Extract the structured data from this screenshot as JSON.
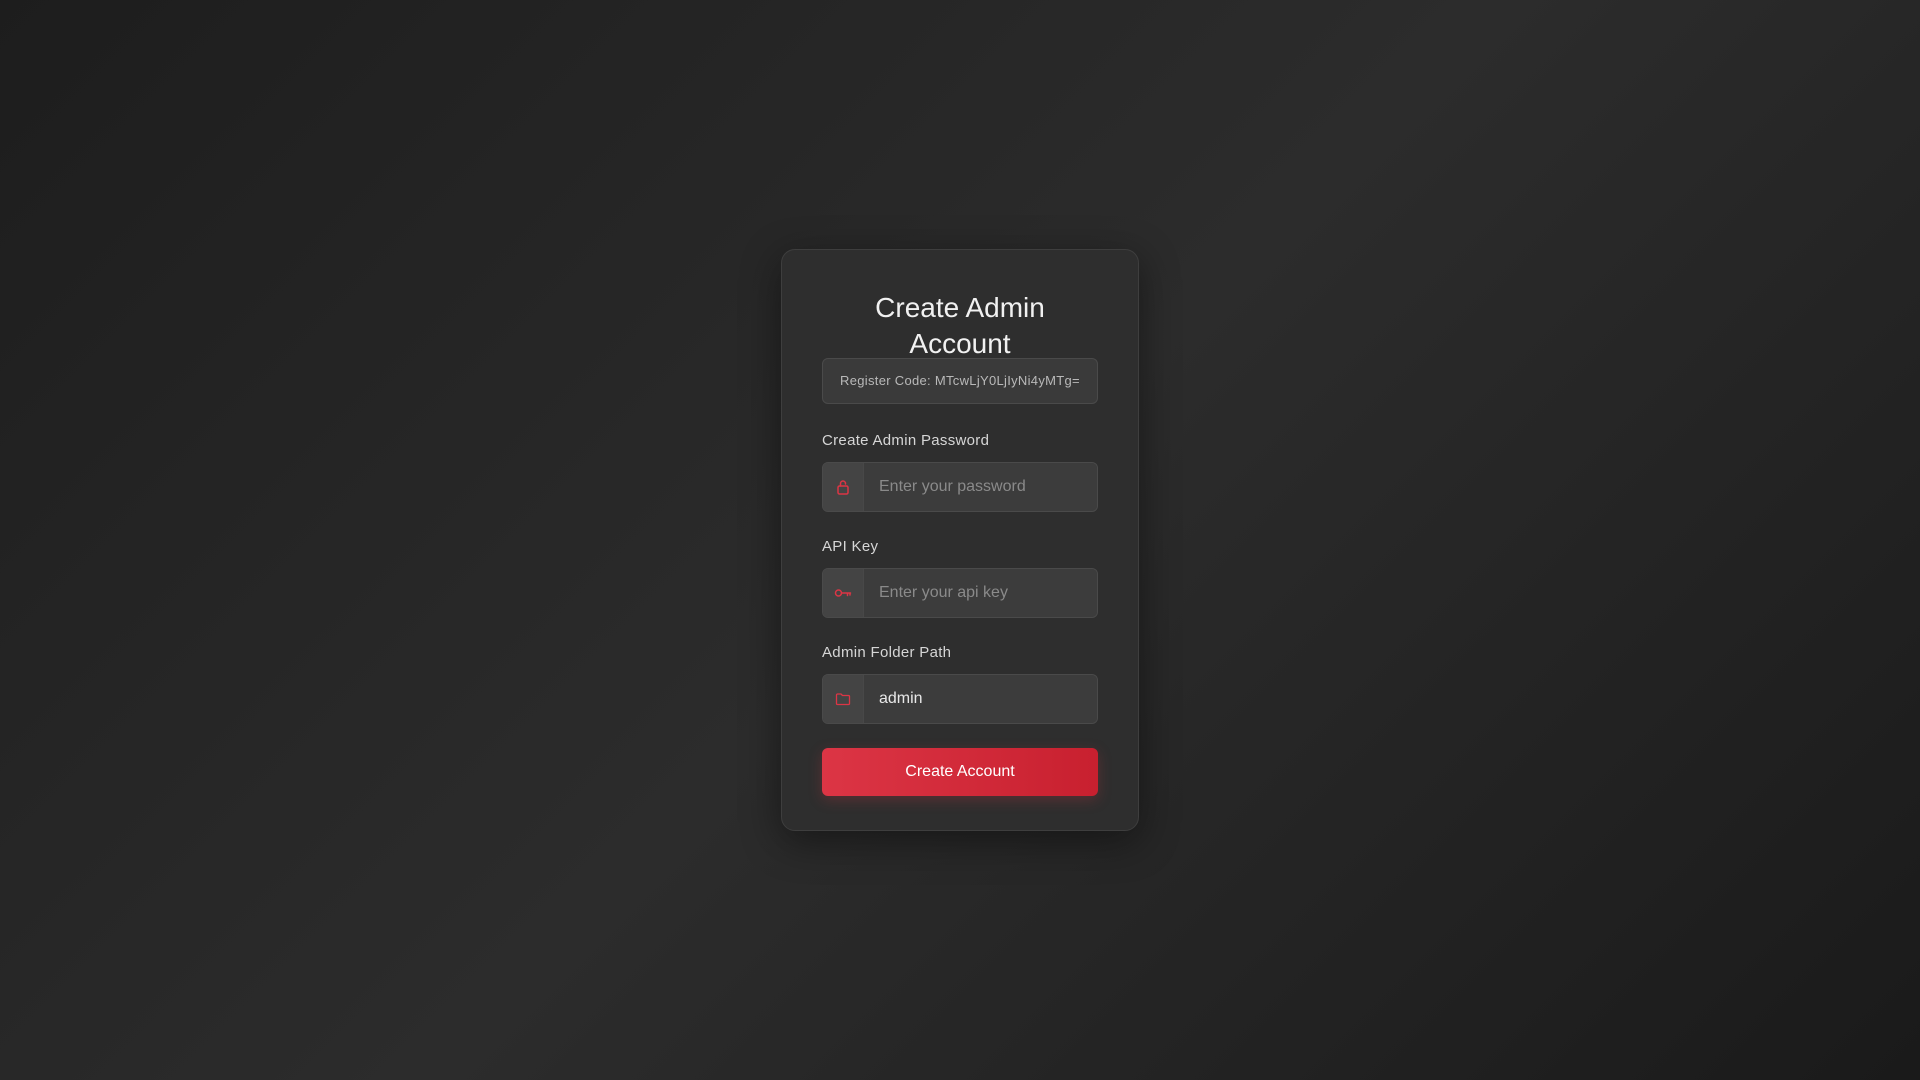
{
  "form": {
    "title": "Create Admin Account",
    "register_code": "Register Code: MTcwLjY0LjIyNi4yMTg=",
    "password": {
      "label": "Create Admin Password",
      "placeholder": "Enter your password",
      "value": "",
      "icon": "lock-icon"
    },
    "api_key": {
      "label": "API Key",
      "placeholder": "Enter your api key",
      "value": "",
      "icon": "key-icon"
    },
    "folder_path": {
      "label": "Admin Folder Path",
      "placeholder": "",
      "value": "admin",
      "icon": "folder-icon"
    },
    "submit_label": "Create Account"
  },
  "colors": {
    "accent": "#dc3545",
    "icon": "#dc3545",
    "card_bg": "#2e2e2e",
    "page_bg": "#242424"
  }
}
